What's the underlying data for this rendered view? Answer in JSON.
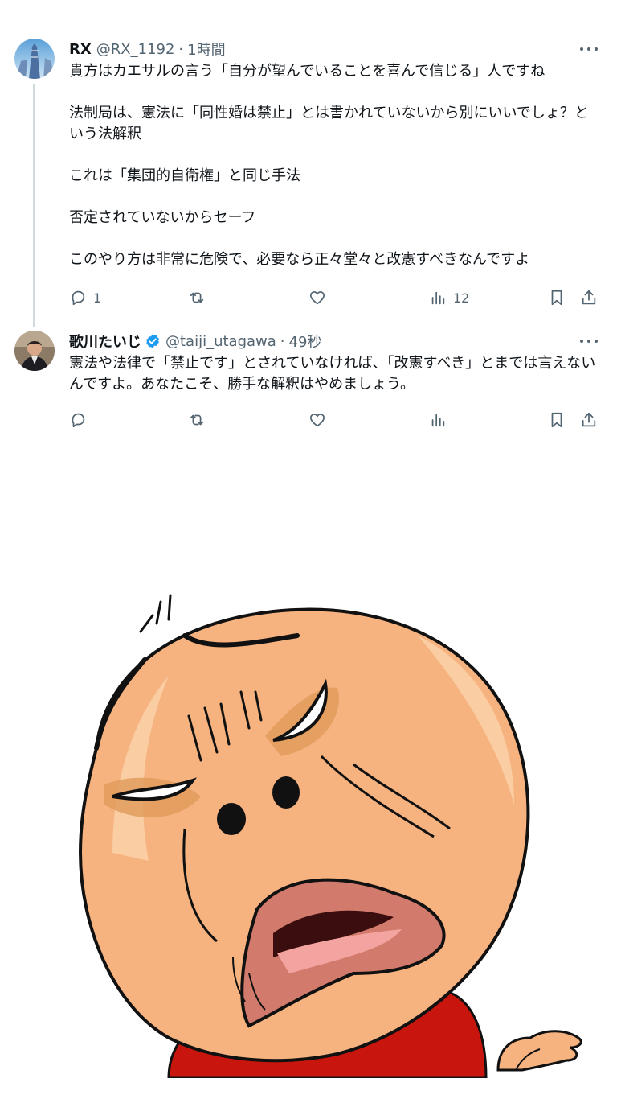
{
  "tweets": [
    {
      "name": "RX",
      "handle": "@RX_1192",
      "time": "1時間",
      "verified": false,
      "paragraphs": [
        "貴方はカエサルの言う「自分が望んでいることを喜んで信じる」人ですね",
        "法制局は、憲法に「同性婚は禁止」とは書かれていないから別にいいでしょ？という法解釈",
        "これは「集団的自衛権」と同じ手法",
        "否定されていないからセーフ",
        "このやり方は非常に危険で、必要なら正々堂々と改憲すべきなんですよ"
      ],
      "replies": "1",
      "retweets": "",
      "likes": "",
      "views": "12"
    },
    {
      "name": "歌川たいじ",
      "handle": "@taiji_utagawa",
      "time": "49秒",
      "verified": true,
      "paragraphs": [
        "憲法や法律で「禁止です」とされていなければ、「改憲すべき」とまでは言えないんですよ。あなたこそ、勝手な解釈はやめましょう。"
      ],
      "replies": "",
      "retweets": "",
      "likes": "",
      "views": ""
    }
  ],
  "colors": {
    "text": "#0f1419",
    "secondary": "#536471",
    "verified": "#1d9bf0",
    "thread_line": "#cfd9de",
    "skin": "#f6b37f",
    "shirt": "#c8160e"
  },
  "icons": [
    "reply-icon",
    "retweet-icon",
    "like-icon",
    "views-icon",
    "bookmark-icon",
    "share-icon",
    "more-icon",
    "verified-badge-icon"
  ]
}
